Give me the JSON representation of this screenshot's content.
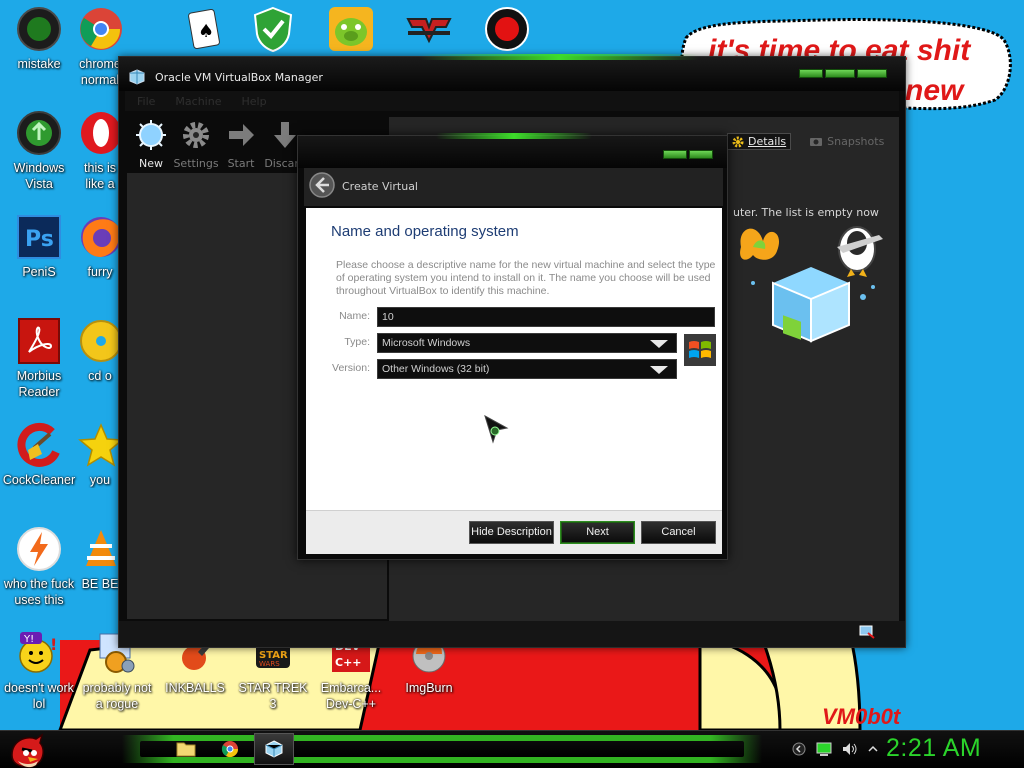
{
  "wallpaper": {
    "graffiti_line1": "it's time to eat shit",
    "graffiti_line2": "new",
    "signature": "VM0b0t",
    "colors": {
      "sky": "#1ea9e8",
      "accent_red": "#e01818"
    }
  },
  "desktop_icons": [
    {
      "label": "mistake",
      "icon": "mistake-icon"
    },
    {
      "label": "chrome normal",
      "icon": "chrome-icon"
    },
    {
      "label": "Windows Vista",
      "icon": "recycle-bin-icon"
    },
    {
      "label": "this is like a",
      "icon": "opera-icon"
    },
    {
      "label": "PeniS",
      "icon": "photoshop-icon"
    },
    {
      "label": "furry",
      "icon": "firefox-icon"
    },
    {
      "label": "Morbius Reader",
      "icon": "pdf-reader-icon"
    },
    {
      "label": "cd o",
      "icon": "cd-icon"
    },
    {
      "label": "CockCleaner",
      "icon": "broom-icon"
    },
    {
      "label": "you",
      "icon": "star-icon"
    },
    {
      "label": "who the fuck uses this",
      "icon": "lightning-icon"
    },
    {
      "label": "BE BE",
      "icon": "vlc-icon"
    },
    {
      "label": "doesn't work lol",
      "icon": "yahoo-messenger-icon"
    },
    {
      "label": "probably not a rogue",
      "icon": "gears-icon"
    },
    {
      "label": "INKBALLS",
      "icon": "inkball-icon"
    },
    {
      "label": "STAR TREK 3",
      "icon": "star-trek-icon"
    },
    {
      "label": "Embarca... Dev-C++",
      "icon": "dev-cpp-icon"
    },
    {
      "label": "ImgBurn",
      "icon": "imgburn-icon"
    }
  ],
  "top_icons": [
    "solitaire-icon",
    "security-shield-icon",
    "bad-piggies-icon",
    "wing-logo-icon",
    "record-button-icon"
  ],
  "vbox": {
    "title": "Oracle VM VirtualBox Manager",
    "menu": [
      "File",
      "Machine",
      "Help"
    ],
    "toolbar": [
      {
        "label": "New",
        "icon": "new-icon",
        "active": true
      },
      {
        "label": "Settings",
        "icon": "settings-icon",
        "active": false
      },
      {
        "label": "Start",
        "icon": "start-arrow-icon",
        "active": false
      },
      {
        "label": "Discard",
        "icon": "discard-arrow-icon",
        "active": false
      }
    ],
    "tabs": {
      "details": "Details",
      "snapshots": "Snapshots"
    },
    "empty_text": "uter. The list is empty now"
  },
  "dialog": {
    "header": "Create Virtual",
    "page_title": "Name and operating system",
    "description": "Please choose a descriptive name for the new virtual machine and select the type of operating system you intend to install on it. The name you choose will be used throughout VirtualBox to identify this machine.",
    "fields": {
      "name": {
        "label": "Name:",
        "value": "10"
      },
      "type": {
        "label": "Type:",
        "value": "Microsoft Windows"
      },
      "version": {
        "label": "Version:",
        "value": "Other Windows (32 bit)"
      }
    },
    "buttons": {
      "hide_description": "Hide Description",
      "next": "Next",
      "cancel": "Cancel"
    }
  },
  "taskbar": {
    "clock": "2:21 AM",
    "accent": "#2bd42b",
    "apps": [
      "folder-icon",
      "chrome-icon",
      "virtualbox-icon"
    ],
    "tray": [
      "back-icon",
      "battery-icon",
      "volume-icon",
      "chevron-up-icon"
    ]
  }
}
